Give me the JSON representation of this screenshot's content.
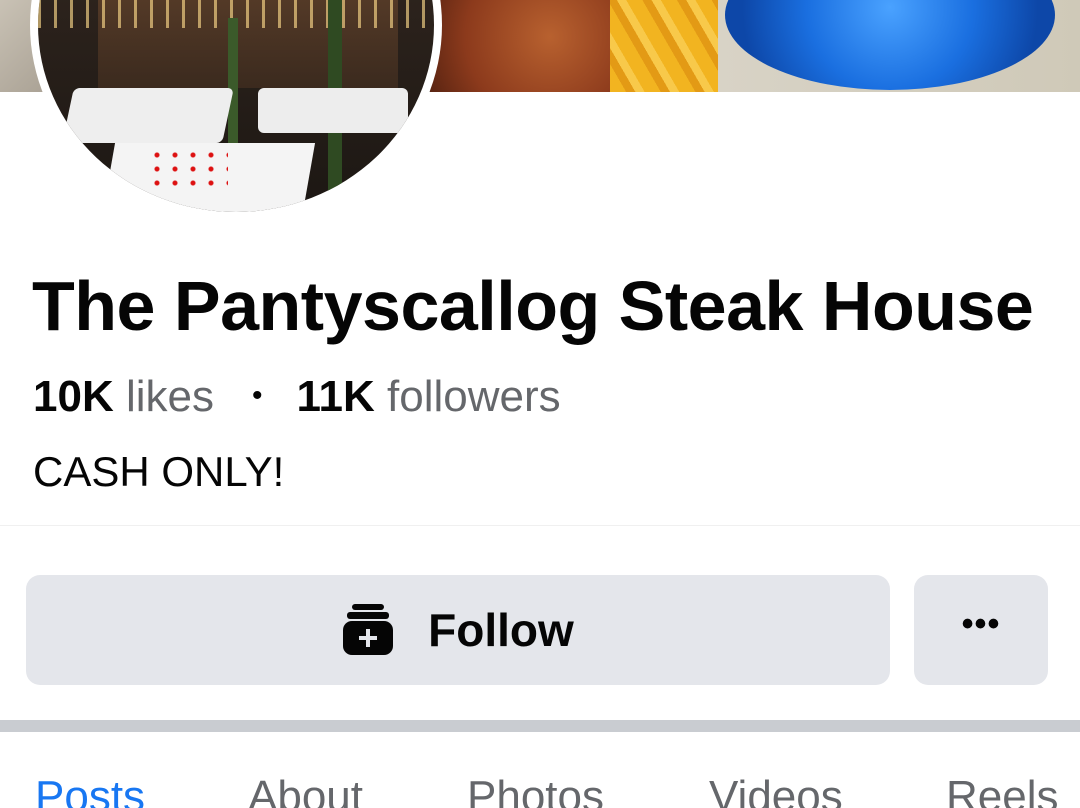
{
  "page": {
    "title": "The Pantyscallog Steak House",
    "likes_count": "10K",
    "likes_label": "likes",
    "separator": "•",
    "followers_count": "11K",
    "followers_label": "followers",
    "bio": "CASH ONLY!"
  },
  "actions": {
    "follow_label": "Follow",
    "follow_icon": "follow-icon",
    "more_label": "•••"
  },
  "tabs": [
    {
      "label": "Posts",
      "active": true
    },
    {
      "label": "About",
      "active": false
    },
    {
      "label": "Photos",
      "active": false
    },
    {
      "label": "Videos",
      "active": false
    },
    {
      "label": "Reels",
      "active": false
    }
  ],
  "colors": {
    "accent": "#1877f2",
    "button_bg": "#e4e6eb",
    "muted_text": "#65676b",
    "divider": "#c9ccd1"
  }
}
